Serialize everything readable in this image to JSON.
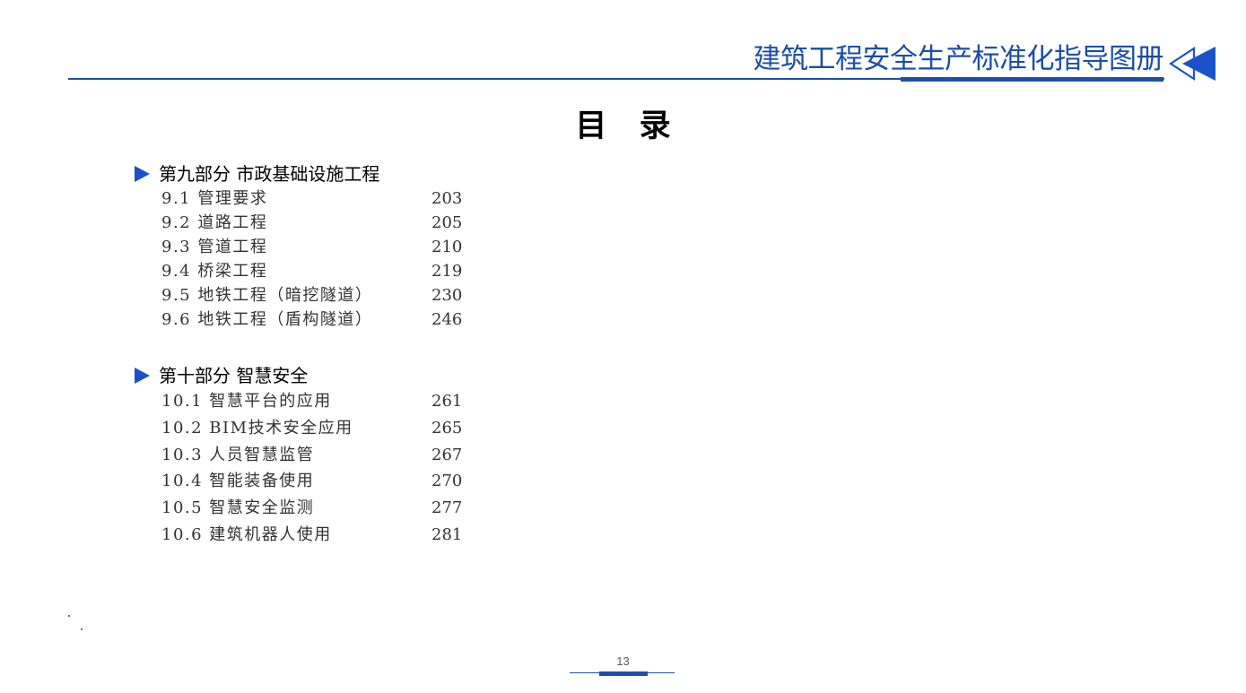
{
  "header": {
    "title": "建筑工程安全生产标准化指导图册",
    "accent_color": "#1f4fa8",
    "arrow_icon": "double-left-arrow-icon"
  },
  "page_title": "目 录",
  "sections": [
    {
      "heading": "第九部分 市政基础设施工程",
      "items": [
        {
          "label": "9.1 管理要求",
          "page": "203"
        },
        {
          "label": "9.2 道路工程",
          "page": "205"
        },
        {
          "label": "9.3 管道工程",
          "page": "210"
        },
        {
          "label": "9.4 桥梁工程",
          "page": "219"
        },
        {
          "label": "9.5 地铁工程（暗挖隧道）",
          "page": "230"
        },
        {
          "label": "9.6 地铁工程（盾构隧道）",
          "page": "246"
        }
      ]
    },
    {
      "heading": "第十部分 智慧安全",
      "items": [
        {
          "label": "10.1 智慧平台的应用",
          "page": "261"
        },
        {
          "label": "10.2 BIM技术安全应用",
          "page": "265"
        },
        {
          "label": "10.3 人员智慧监管",
          "page": "267"
        },
        {
          "label": "10.4 智能装备使用",
          "page": "270"
        },
        {
          "label": "10.5 智慧安全监测",
          "page": "277"
        },
        {
          "label": "10.6 建筑机器人使用",
          "page": "281"
        }
      ]
    }
  ],
  "footer": {
    "page_number": "13"
  }
}
